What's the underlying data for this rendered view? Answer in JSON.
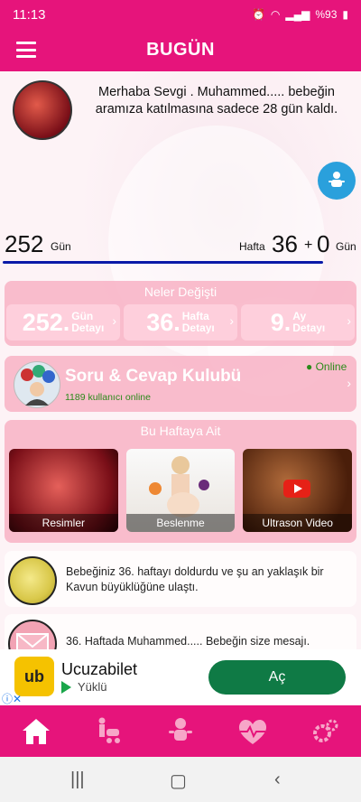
{
  "status": {
    "time": "11:13",
    "battery": "%93"
  },
  "appbar": {
    "title": "BUGÜN"
  },
  "greeting": "Merhaba Sevgi . Muhammed..... bebeğin aramıza katılmasına sadece 28 gün kaldı.",
  "counters": {
    "days": "252",
    "days_unit": "Gün",
    "week_label": "Hafta",
    "weeks": "36",
    "plus": "+",
    "extra_days": "0",
    "extra_unit": "Gün",
    "progress": 0.9
  },
  "changes": {
    "title": "Neler Değişti",
    "items": [
      {
        "num": "252.",
        "line1": "Gün",
        "line2": "Detayı"
      },
      {
        "num": "36.",
        "line1": "Hafta",
        "line2": "Detayı"
      },
      {
        "num": "9.",
        "line1": "Ay",
        "line2": "Detayı"
      }
    ]
  },
  "qa": {
    "title": "Soru & Cevap Kulubü",
    "subtitle": "1189 kullanıcı online",
    "online": "Online"
  },
  "week": {
    "title": "Bu Haftaya Ait",
    "tiles": [
      "Resimler",
      "Beslenme",
      "Ultrason Video"
    ]
  },
  "messages": [
    {
      "text": "Bebeğiniz 36. haftayı doldurdu ve şu an yaklaşık bir Kavun büyüklüğüne ulaştı."
    },
    {
      "text": "36. Haftada Muhammed..... Bebeğin size mesajı."
    }
  ],
  "ad": {
    "logo": "ub",
    "name": "Ucuzabilet",
    "installed": "Yüklü",
    "button": "Aç",
    "info": "ⓘ",
    "close": "✕"
  },
  "colors": {
    "primary": "#e6147b",
    "card": "#f8b2c4",
    "accent_blue": "#2aa0dc",
    "online_green": "#2b8a1a"
  }
}
